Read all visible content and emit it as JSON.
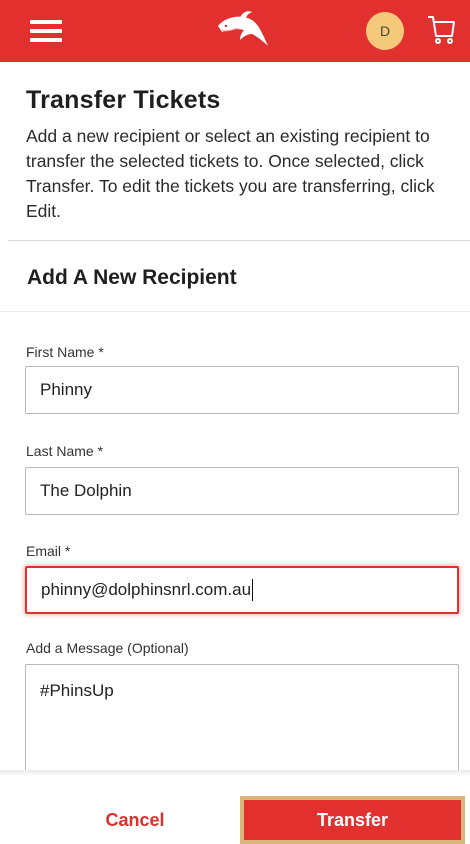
{
  "header": {
    "menu_icon": "hamburger-menu-icon",
    "logo_icon": "dolphin-logo-icon",
    "avatar_initial": "D",
    "cart_icon": "shopping-cart-icon",
    "brand_color": "#e1302e"
  },
  "page": {
    "title": "Transfer Tickets",
    "intro": "Add a new recipient or select an existing recipient to transfer the selected tickets to. Once selected, click Transfer. To edit the tickets you are transferring, click Edit."
  },
  "form": {
    "section_title": "Add A New Recipient",
    "first_name": {
      "label": "First Name *",
      "value": "Phinny"
    },
    "last_name": {
      "label": "Last Name *",
      "value": "The Dolphin"
    },
    "email": {
      "label": "Email *",
      "value": "phinny@dolphinsnrl.com.au"
    },
    "message": {
      "label": "Add a Message (Optional)",
      "value": "#PhinsUp"
    }
  },
  "actions": {
    "cancel_label": "Cancel",
    "transfer_label": "Transfer"
  }
}
